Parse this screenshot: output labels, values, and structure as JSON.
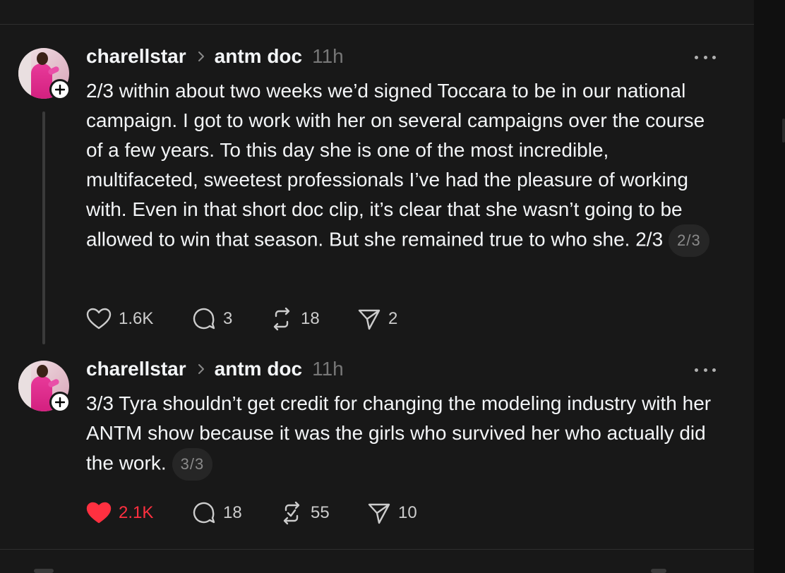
{
  "posts": [
    {
      "username": "charellstar",
      "topic": "antm doc",
      "time": "11h",
      "text": "2/3 within about two weeks we’d signed Toccara to be in our national campaign. I got to work with her on several campaigns over the course of a few years. To this day she is one of the most incredible, multifaceted, sweetest professionals I’ve had the pleasure of working with. Even in that short doc clip, it’s clear that she wasn’t going to be allowed to win that season. But she remained true to who she. 2/3",
      "page_badge": "2/3",
      "likes": "1.6K",
      "replies": "3",
      "reposts": "18",
      "shares": "2",
      "liked": false
    },
    {
      "username": "charellstar",
      "topic": "antm doc",
      "time": "11h",
      "text": "3/3 Tyra shouldn’t get credit for changing the modeling industry with her ANTM show because it was the girls who survived her who actually did the work.",
      "page_badge": "3/3",
      "likes": "2.1K",
      "replies": "18",
      "reposts": "55",
      "shares": "10",
      "liked": true
    }
  ],
  "colors": {
    "background": "#181818",
    "text": "#f3f5f7",
    "muted": "#777777",
    "like_active": "#ff3040"
  },
  "icons": [
    "plus-icon",
    "chevron-right-icon",
    "more-icon",
    "heart-icon",
    "reply-icon",
    "repost-icon",
    "share-icon"
  ]
}
